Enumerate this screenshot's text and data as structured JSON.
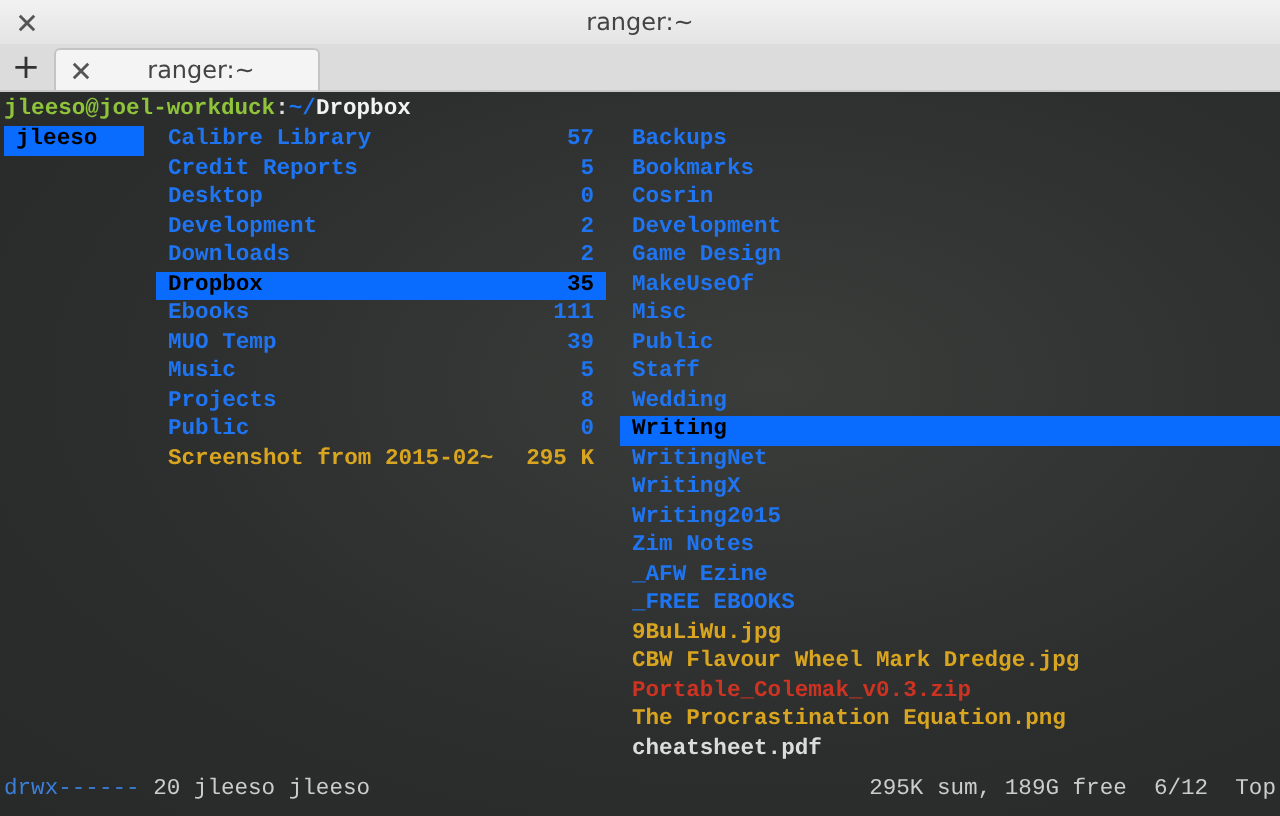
{
  "window": {
    "title": "ranger:~"
  },
  "new_tab_button": "+",
  "tabs": [
    {
      "label": "ranger:~",
      "selected": true
    }
  ],
  "prompt": {
    "user_host": "jleeso@joel-workduck",
    "separator": ":",
    "path_home": "~/",
    "path_dir": "Dropbox"
  },
  "parent_column": [
    {
      "name": "jleeso",
      "selected": true
    }
  ],
  "current_column": [
    {
      "name": "Calibre Library",
      "size": "57",
      "kind": "dir",
      "selected": false
    },
    {
      "name": "Credit Reports",
      "size": "5",
      "kind": "dir",
      "selected": false
    },
    {
      "name": "Desktop",
      "size": "0",
      "kind": "dir",
      "selected": false
    },
    {
      "name": "Development",
      "size": "2",
      "kind": "dir",
      "selected": false
    },
    {
      "name": "Downloads",
      "size": "2",
      "kind": "dir",
      "selected": false
    },
    {
      "name": "Dropbox",
      "size": "35",
      "kind": "dir",
      "selected": true
    },
    {
      "name": "Ebooks",
      "size": "111",
      "kind": "dir",
      "selected": false
    },
    {
      "name": "MUO Temp",
      "size": "39",
      "kind": "dir",
      "selected": false
    },
    {
      "name": "Music",
      "size": "5",
      "kind": "dir",
      "selected": false
    },
    {
      "name": "Projects",
      "size": "8",
      "kind": "dir",
      "selected": false
    },
    {
      "name": "Public",
      "size": "0",
      "kind": "dir",
      "selected": false
    },
    {
      "name": "Screenshot from 2015-02~",
      "size": "295 K",
      "kind": "image",
      "selected": false
    }
  ],
  "preview_column": [
    {
      "name": "Backups",
      "kind": "dir",
      "selected": false
    },
    {
      "name": "Bookmarks",
      "kind": "dir",
      "selected": false
    },
    {
      "name": "Cosrin",
      "kind": "dir",
      "selected": false
    },
    {
      "name": "Development",
      "kind": "dir",
      "selected": false
    },
    {
      "name": "Game Design",
      "kind": "dir",
      "selected": false
    },
    {
      "name": "MakeUseOf",
      "kind": "dir",
      "selected": false
    },
    {
      "name": "Misc",
      "kind": "dir",
      "selected": false
    },
    {
      "name": "Public",
      "kind": "dir",
      "selected": false
    },
    {
      "name": "Staff",
      "kind": "dir",
      "selected": false
    },
    {
      "name": "Wedding",
      "kind": "dir",
      "selected": false
    },
    {
      "name": "Writing",
      "kind": "dir",
      "selected": true
    },
    {
      "name": "WritingNet",
      "kind": "dir",
      "selected": false
    },
    {
      "name": "WritingX",
      "kind": "dir",
      "selected": false
    },
    {
      "name": "Writing2015",
      "kind": "dir",
      "selected": false
    },
    {
      "name": "Zim Notes",
      "kind": "dir",
      "selected": false
    },
    {
      "name": "_AFW Ezine",
      "kind": "dir",
      "selected": false
    },
    {
      "name": "_FREE EBOOKS",
      "kind": "dir",
      "selected": false
    },
    {
      "name": "9BuLiWu.jpg",
      "kind": "image",
      "selected": false
    },
    {
      "name": "CBW Flavour Wheel Mark Dredge.jpg",
      "kind": "image",
      "selected": false
    },
    {
      "name": "Portable_Colemak_v0.3.zip",
      "kind": "archive",
      "selected": false
    },
    {
      "name": "The Procrastination Equation.png",
      "kind": "image",
      "selected": false
    },
    {
      "name": "cheatsheet.pdf",
      "kind": "file",
      "selected": false
    }
  ],
  "status_bar": {
    "permissions": "drwx------",
    "info": "20 jleeso jleeso",
    "summary": "295K sum, 189G free",
    "position": "6/12",
    "scroll": "Top"
  }
}
